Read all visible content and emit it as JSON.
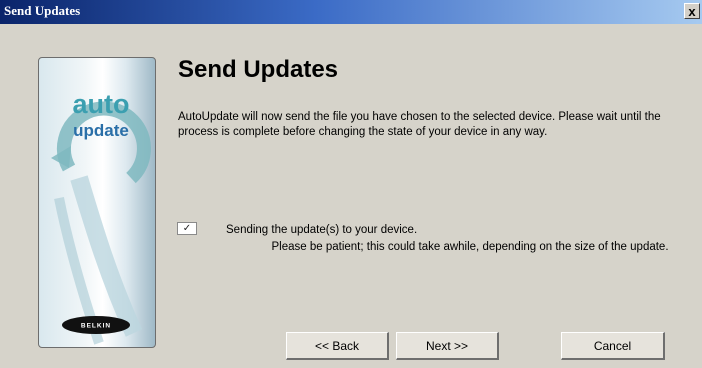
{
  "window": {
    "title": "Send Updates",
    "close_label": "x"
  },
  "logo": {
    "line1": "auto",
    "line2": "update",
    "brand": "BELKIN"
  },
  "main": {
    "heading": "Send Updates",
    "description": "AutoUpdate will now send the file you have chosen to the selected device. Please wait until the process is complete before changing the state of your device in any way.",
    "check_mark": "✓",
    "status": "Sending the update(s) to your device.",
    "note": "Please be patient; this could take awhile, depending on the size of the update."
  },
  "buttons": {
    "back": "<< Back",
    "next": "Next >>",
    "cancel": "Cancel"
  },
  "colors": {
    "title_bar": "#0a246a",
    "logo_accent": "#3b9fb0",
    "logo_blue": "#2a6fa8"
  }
}
